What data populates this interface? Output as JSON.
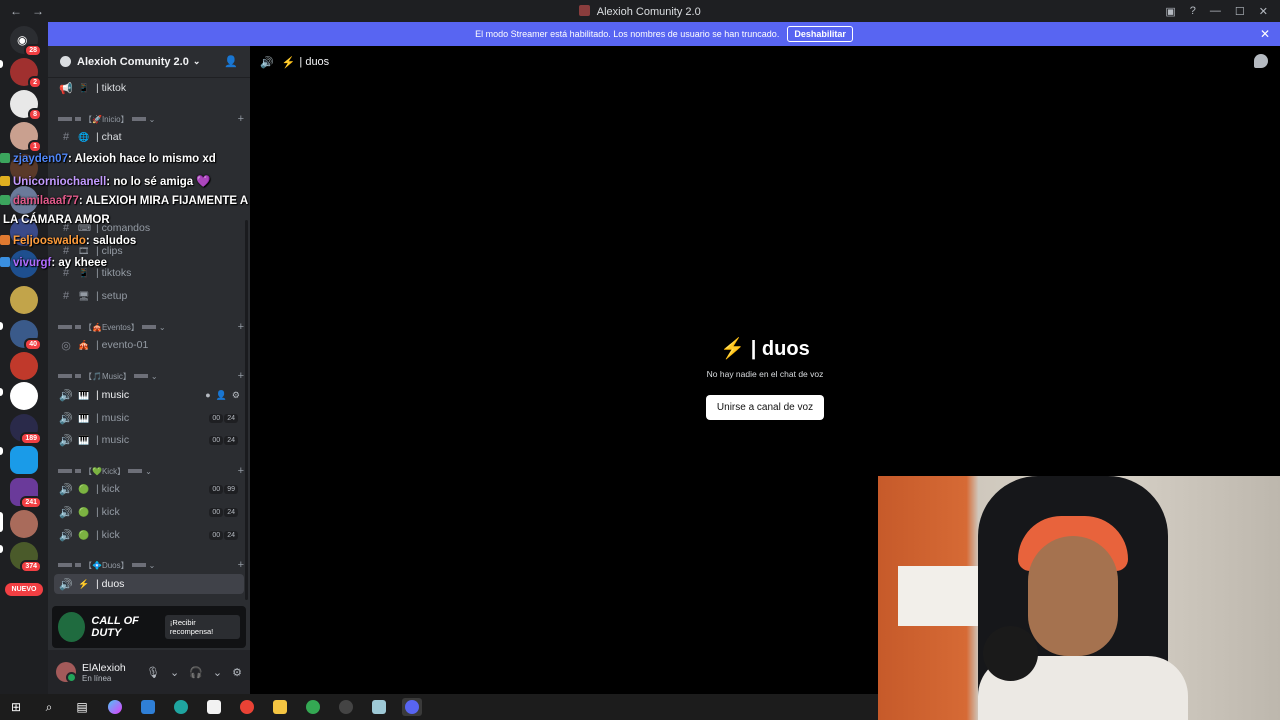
{
  "window": {
    "title": "Alexioh Comunity 2.0",
    "back": "←",
    "forward": "→"
  },
  "banner": {
    "text": "El modo Streamer está habilitado. Los nombres de usuario se han truncado.",
    "button": "Deshabilitar"
  },
  "servers": [
    {
      "badge": "28",
      "color": "#2b2d31"
    },
    {
      "badge": "2",
      "color": "#a0302f"
    },
    {
      "badge": "8",
      "color": "#e8e8e8"
    },
    {
      "badge": "1",
      "color": "#c9a08f"
    },
    {
      "badge": "",
      "color": "#5a3a2a"
    },
    {
      "badge": "",
      "color": "#6a7a9a"
    },
    {
      "badge": "",
      "color": "#3a4a8a"
    },
    {
      "badge": "",
      "color": "#1e4f8f"
    },
    {
      "badge": "",
      "color": "#c2a44a"
    },
    {
      "badge": "40",
      "color": "#3a5a8a"
    },
    {
      "badge": "",
      "color": "#c0392b"
    },
    {
      "badge": "",
      "color": "#ffffff"
    },
    {
      "badge": "189",
      "color": "#2a2a4a"
    },
    {
      "badge": "",
      "color": "#1a9be8"
    },
    {
      "badge": "241",
      "color": "#6a3a9a"
    },
    {
      "badge": "",
      "color": "#a96b5b"
    },
    {
      "badge": "374",
      "color": "#4a5a2a"
    }
  ],
  "nuevo": "NUEVO",
  "guild": {
    "name": "Alexioh Comunity 2.0"
  },
  "channels": {
    "tiktok_top": "| tiktok",
    "cat_inicio": "【🚀Inicio】",
    "chat": "| chat",
    "comandos": "| comandos",
    "clips": "| clips",
    "tiktoks": "| tiktoks",
    "setup": "| setup",
    "cat_eventos": "【🎪Eventos】",
    "evento": "| evento-01",
    "cat_music": "【🎵Music】",
    "music1": "| music",
    "music2": "| music",
    "music3": "| music",
    "cat_kick": "【💚Kick】",
    "kick1": "| kick",
    "kick2": "| kick",
    "kick3": "| kick",
    "cat_duos": "【💠Duos】",
    "duos": "| duos",
    "counts": {
      "music2": [
        "00",
        "24"
      ],
      "music3": [
        "00",
        "24"
      ],
      "kick1": [
        "00",
        "99"
      ],
      "kick2": [
        "00",
        "24"
      ],
      "kick3": [
        "00",
        "24"
      ]
    }
  },
  "chat_overlay": [
    {
      "user": "zjayden07",
      "text": ": Alexioh hace lo mismo xd",
      "color": "#4f86f7"
    },
    {
      "user": "Unicorniochanell",
      "text": ": no lo sé amiga 💜",
      "color": "#c39bff"
    },
    {
      "user": "damilaaaf77",
      "text": ": ALEXIOH MIRA FIJAMENTE A",
      "color": "#e05a8a"
    },
    {
      "user": "",
      "text": "LA CÁMARA AMOR",
      "color": "#ffffff"
    },
    {
      "user": "Feljooswaldo",
      "text": ": saludos",
      "color": "#ff9d3c"
    },
    {
      "user": "vivurgf",
      "text": ": ay kheee",
      "color": "#b06cff"
    }
  ],
  "promo": {
    "title": "CALL OF DUTY",
    "cta": "¡Recibir recompensa!"
  },
  "user": {
    "name": "ElAlexioh",
    "status": "En línea"
  },
  "main": {
    "channel": "| duos",
    "empty_title": "| duos",
    "empty_sub": "No hay nadie en el chat de voz",
    "join": "Unirse a canal de voz"
  },
  "colors": {
    "accent": "#5865f2",
    "sidebar": "#2b2d31",
    "rail": "#1e1f22"
  }
}
